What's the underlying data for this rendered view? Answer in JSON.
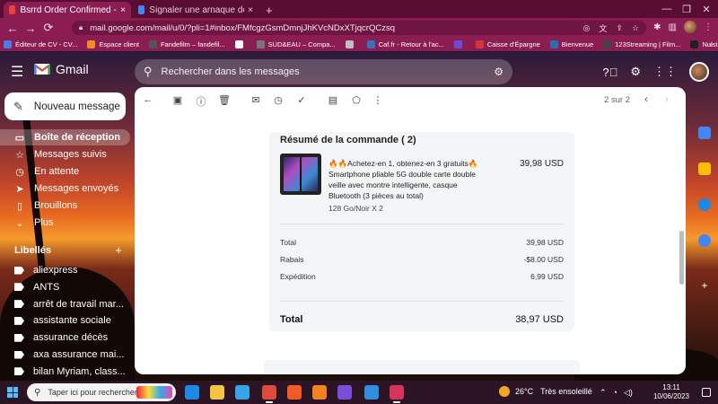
{
  "browser": {
    "tabs": [
      {
        "title": "Bsrrd Order Confirmed - cristalin",
        "close": "×",
        "active": true,
        "favicon_color": "#ea4335"
      },
      {
        "title": "Signaler une arnaque découvert",
        "close": "×",
        "active": false,
        "favicon_color": "#4285f4"
      }
    ],
    "new_tab": "+",
    "window_controls": {
      "minimize": "—",
      "maximize": "❐",
      "close": "✕"
    },
    "url": "mail.google.com/mail/u/0/?pli=1#inbox/FMfcgzGsmDmnjJhKVcNDxXTjqcrQCzsq",
    "nav": {
      "back": "←",
      "forward": "→",
      "reload": "⟳"
    },
    "bookmarks": [
      {
        "label": "Éditeur de CV - CV...",
        "color": "#4a7be0"
      },
      {
        "label": "Espace client",
        "color": "#f28c28"
      },
      {
        "label": "Fandefilm – fandefil...",
        "color": "#555555"
      },
      {
        "label": "",
        "color": "#ffffff"
      },
      {
        "label": "SUD&EAU – Compa...",
        "color": "#777777"
      },
      {
        "label": "",
        "color": "#c0c0c0"
      },
      {
        "label": "Caf.fr - Retour à l'ac...",
        "color": "#3a70c0"
      },
      {
        "label": "",
        "color": "#6b4cd6"
      },
      {
        "label": "Caisse d'Épargne",
        "color": "#d33"
      },
      {
        "label": "Bienvenue",
        "color": "#2a6fb0"
      },
      {
        "label": "123Streaming | Film...",
        "color": "#444444"
      },
      {
        "label": "Nulstream",
        "color": "#222222"
      }
    ],
    "bookmarks_more": "»"
  },
  "gmail": {
    "app_name": "Gmail",
    "search_placeholder": "Rechercher dans les messages",
    "compose_label": "Nouveau message",
    "nav": [
      {
        "label": "Boîte de réception",
        "icon": "inbox-icon",
        "glyph": "▭",
        "selected": true
      },
      {
        "label": "Messages suivis",
        "icon": "star-icon",
        "glyph": "☆",
        "selected": false
      },
      {
        "label": "En attente",
        "icon": "clock-icon",
        "glyph": "◷",
        "selected": false
      },
      {
        "label": "Messages envoyés",
        "icon": "send-icon",
        "glyph": "➤",
        "selected": false
      },
      {
        "label": "Brouillons",
        "icon": "draft-icon",
        "glyph": "▯",
        "selected": false
      },
      {
        "label": "Plus",
        "icon": "chevron-down-icon",
        "glyph": "⌄",
        "selected": false
      }
    ],
    "labels_header": "Libellés",
    "labels_add": "+",
    "labels": [
      "aliexpress",
      "ANTS",
      "arrêt de travail mar...",
      "assistante sociale",
      "assurance décès",
      "axa assurance mai...",
      "bilan Myriam, class..."
    ],
    "toolbar": {
      "pager": "2 sur 2"
    }
  },
  "order": {
    "section_title": "Résumé de la commande  ( 2)",
    "product_description": "🔥🔥Achetez-en 1, obtenez-en 3 gratuits🔥 Smartphone pliable 5G double carte double veille avec montre intelligente, casque Bluetooth (3 pièces au total)",
    "product_variant": "128 Go/Noir X 2",
    "product_price": "39,98 USD",
    "summary": [
      {
        "label": "Total",
        "value": "39,98 USD"
      },
      {
        "label": "Rabais",
        "value": "-$8.00 USD"
      },
      {
        "label": "Expédition",
        "value": "6,99 USD"
      }
    ],
    "grand_total_label": "Total",
    "grand_total_value": "38,97 USD"
  },
  "taskbar": {
    "search_placeholder": "Taper ici pour rechercher",
    "weather_temp": "26°C",
    "weather_text": "Très ensoleillé",
    "time": "13:11",
    "date": "10/06/2023",
    "apps": [
      {
        "name": "edge-icon",
        "color": "#1e88e5"
      },
      {
        "name": "file-explorer-icon",
        "color": "#f6c343"
      },
      {
        "name": "store-icon",
        "color": "#35a4e8"
      },
      {
        "name": "chrome-icon",
        "color": "#e04a3a"
      },
      {
        "name": "brave-icon",
        "color": "#f05a24"
      },
      {
        "name": "vlc-icon",
        "color": "#f58220"
      },
      {
        "name": "media-player-icon",
        "color": "#7a4ed8"
      },
      {
        "name": "mail-icon",
        "color": "#2f8ee0"
      },
      {
        "name": "app-icon",
        "color": "#d8335a"
      }
    ]
  },
  "colors": {
    "browser_frame": "#8b1d52",
    "tab_strip": "#5a0d33",
    "selected_nav": "rgba(255,255,255,.25)"
  }
}
